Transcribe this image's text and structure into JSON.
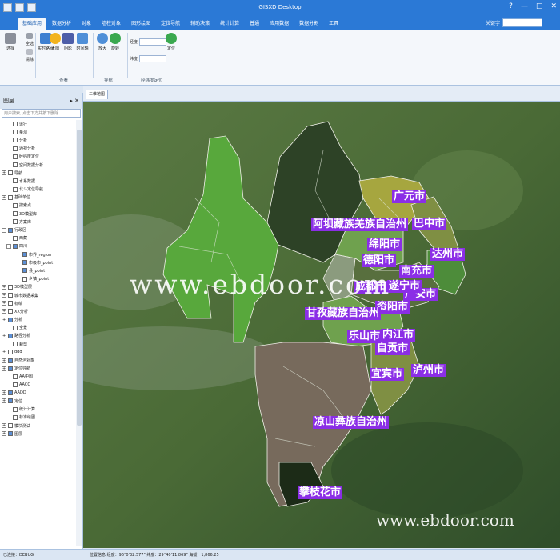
{
  "titlebar": {
    "title": "GISXD Desktop",
    "controls": [
      "?",
      "—",
      "□",
      "✕"
    ]
  },
  "menu": {
    "tabs": [
      "基础应用",
      "数据分析",
      "对象",
      "墙柱对象",
      "图形绘图",
      "定位导航",
      "辅助决策",
      "统计计算",
      "普通",
      "应用数据",
      "数据分割",
      "工具"
    ],
    "search_label": "关键字"
  },
  "ribbon": {
    "buttons": [
      {
        "label": "选择",
        "color": "#8a8f9a"
      },
      {
        "label": "全选",
        "color": "#9aa0aa"
      },
      {
        "label": "清除",
        "color": "#b9bdc5"
      },
      {
        "label": "实时路网",
        "color": "#3d7fd1"
      },
      {
        "label": "太阳",
        "color": "#f2b31d"
      },
      {
        "label": "阴影",
        "color": "#4d5ea8"
      },
      {
        "label": "时间轴",
        "color": "#4f8fd8"
      },
      {
        "label": "放大",
        "color": "#4f8fd8"
      },
      {
        "label": "旋转",
        "color": "#3aa84f"
      },
      {
        "label": "定位",
        "color": "#3aa84f"
      }
    ],
    "groups": [
      "查看",
      "导航",
      "经纬度定位"
    ],
    "lon_label": "经度",
    "lat_label": "纬度"
  },
  "panel": {
    "title": "图层",
    "search_placeholder": "用户搜索, 点击下方并按下删除",
    "pin": "▸ ✕",
    "rows": [
      {
        "label": "运行",
        "indent": 1,
        "toggle": "",
        "check": false
      },
      {
        "label": "量测",
        "indent": 1,
        "toggle": "",
        "check": false
      },
      {
        "label": "分析",
        "indent": 1,
        "toggle": "",
        "check": false
      },
      {
        "label": "通视分析",
        "indent": 1,
        "toggle": "",
        "check": false
      },
      {
        "label": "经纬度定位",
        "indent": 1,
        "toggle": "",
        "check": false
      },
      {
        "label": "空间数据分析",
        "indent": 1,
        "toggle": "",
        "check": false
      },
      {
        "label": "导航",
        "indent": 0,
        "toggle": "+",
        "check": false
      },
      {
        "label": "水系数据",
        "indent": 1,
        "toggle": "",
        "check": false
      },
      {
        "label": "北斗定位导航",
        "indent": 1,
        "toggle": "",
        "check": false
      },
      {
        "label": "基础单位",
        "indent": 0,
        "toggle": "+",
        "check": false
      },
      {
        "label": "搜索点",
        "indent": 1,
        "toggle": "",
        "check": false
      },
      {
        "label": "3D模型库",
        "indent": 1,
        "toggle": "",
        "check": false
      },
      {
        "label": "方案库",
        "indent": 1,
        "toggle": "",
        "check": false
      },
      {
        "label": "行政区",
        "indent": 0,
        "toggle": "-",
        "check": true
      },
      {
        "label": "西藏",
        "indent": 1,
        "toggle": "",
        "check": false
      },
      {
        "label": "四川",
        "indent": 1,
        "toggle": "-",
        "check": true
      },
      {
        "label": "市界_region",
        "indent": 3,
        "toggle": "",
        "check": true
      },
      {
        "label": "市级市_point",
        "indent": 3,
        "toggle": "",
        "check": true
      },
      {
        "label": "县_point",
        "indent": 3,
        "toggle": "",
        "check": true
      },
      {
        "label": "乡镇_point",
        "indent": 3,
        "toggle": "",
        "check": false
      },
      {
        "label": "3D模型层",
        "indent": 0,
        "toggle": "+",
        "check": false
      },
      {
        "label": "城市数据采集",
        "indent": 0,
        "toggle": "+",
        "check": false
      },
      {
        "label": "标绘",
        "indent": 0,
        "toggle": "+",
        "check": false
      },
      {
        "label": "XX分析",
        "indent": 0,
        "toggle": "+",
        "check": false
      },
      {
        "label": "分析",
        "indent": 0,
        "toggle": "+",
        "check": true
      },
      {
        "label": "全景",
        "indent": 1,
        "toggle": "",
        "check": false
      },
      {
        "label": "路径分析",
        "indent": 0,
        "toggle": "+",
        "check": true
      },
      {
        "label": "裁剪",
        "indent": 1,
        "toggle": "",
        "check": false
      },
      {
        "label": "ddd",
        "indent": 0,
        "toggle": "+",
        "check": false
      },
      {
        "label": "自然河对象",
        "indent": 0,
        "toggle": "+",
        "check": true
      },
      {
        "label": "定位导航",
        "indent": 0,
        "toggle": "+",
        "check": true
      },
      {
        "label": "AA中国",
        "indent": 1,
        "toggle": "",
        "check": false
      },
      {
        "label": "AACC",
        "indent": 1,
        "toggle": "",
        "check": false
      },
      {
        "label": "AADD",
        "indent": 0,
        "toggle": "+",
        "check": true
      },
      {
        "label": "定位",
        "indent": 0,
        "toggle": "+",
        "check": true
      },
      {
        "label": "统计计算",
        "indent": 1,
        "toggle": "",
        "check": false
      },
      {
        "label": "标准绘图",
        "indent": 1,
        "toggle": "",
        "check": false
      },
      {
        "label": "模块测试",
        "indent": 0,
        "toggle": "+",
        "check": false
      },
      {
        "label": "图层",
        "indent": 0,
        "toggle": "+",
        "check": true
      }
    ]
  },
  "map": {
    "tab_label": "三维地图",
    "regions": [
      {
        "color": "#58a83c"
      },
      {
        "color": "#2d4226"
      },
      {
        "color": "#6fa14e"
      },
      {
        "color": "#7f8f43"
      },
      {
        "color": "#a6a63f"
      },
      {
        "color": "#8b9b7e"
      },
      {
        "color": "#4d8c3a"
      },
      {
        "color": "#586f3e"
      },
      {
        "color": "#776a5c"
      },
      {
        "color": "#1c2b17"
      }
    ],
    "cities": [
      "广元市",
      "巴中市",
      "阿坝藏族羌族自治州",
      "绵阳市",
      "达州市",
      "德阳市",
      "南充市",
      "广安市",
      "成都市",
      "遂宁市",
      "资阳市",
      "甘孜藏族自治州",
      "内江市",
      "乐山市",
      "自贡市",
      "泸州市",
      "宜宾市",
      "凉山彝族自治州",
      "攀枝花市"
    ]
  },
  "watermark": "www.ebdoor.com",
  "statusbar": {
    "text1": "已连接：DEBUG",
    "text2": "位置信息  经度：96°0'32.577\"  纬度：29°40'11.869\"  海拔：1,866.25"
  }
}
